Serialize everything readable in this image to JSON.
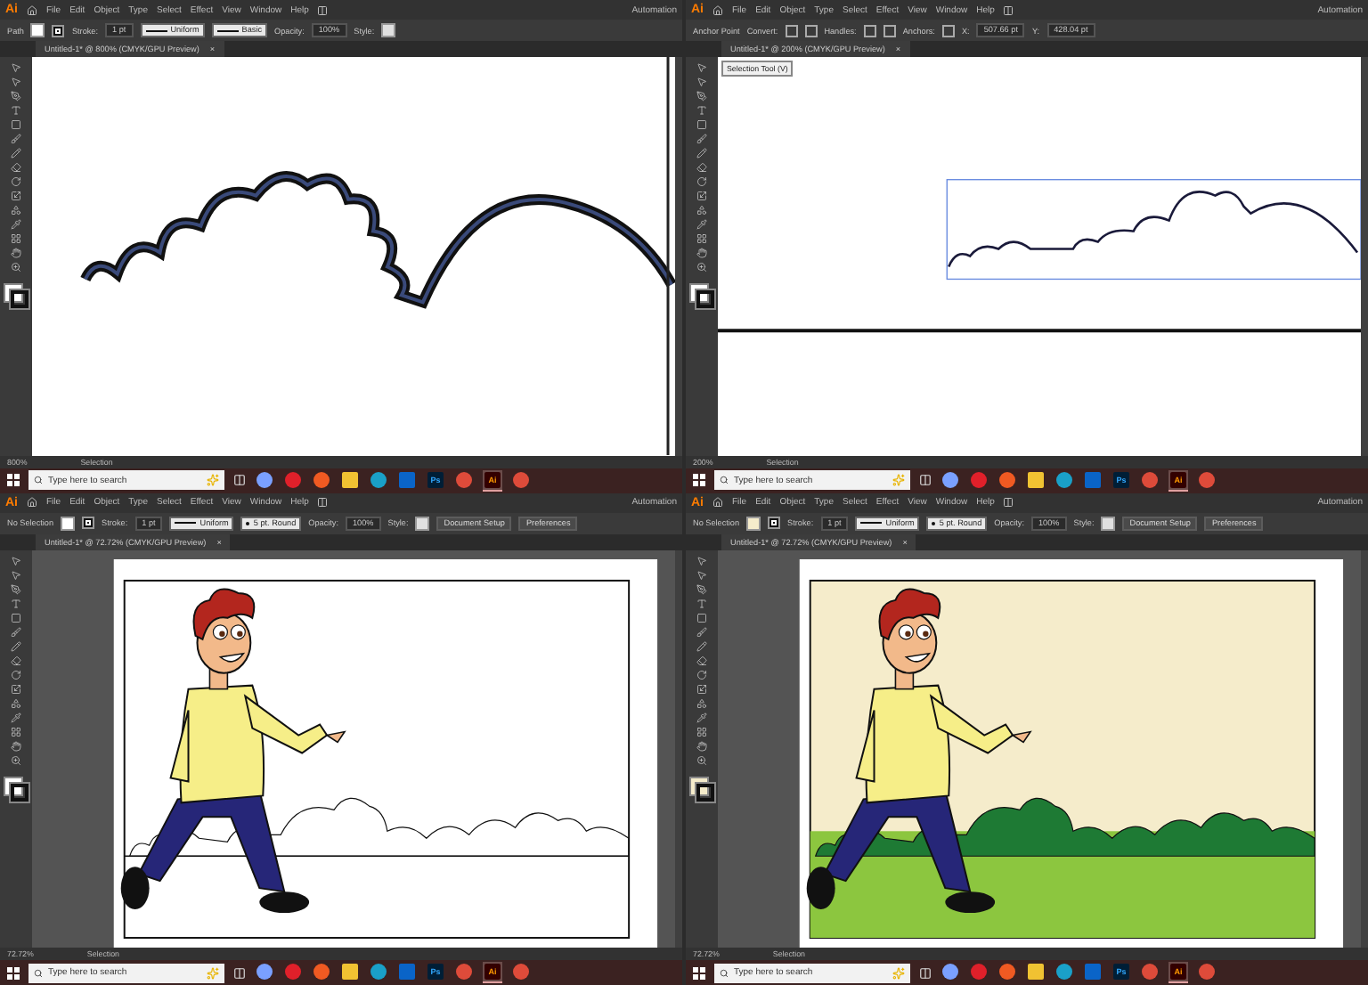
{
  "panes": [
    {
      "kind": "outline-zoom",
      "logo": "Ai",
      "menu": [
        "File",
        "Edit",
        "Object",
        "Type",
        "Select",
        "Effect",
        "View",
        "Window",
        "Help"
      ],
      "workspace": "Automation",
      "color": "#ffffff",
      "controls": [
        {
          "kind": "label",
          "text": "Path"
        },
        {
          "kind": "fill-swatch"
        },
        {
          "kind": "stroke-swatch"
        },
        {
          "kind": "label",
          "text": "Stroke:"
        },
        {
          "kind": "field",
          "text": "1 pt"
        },
        {
          "kind": "stroke-style",
          "text": "Uniform"
        },
        {
          "kind": "stroke-style",
          "text": "Basic"
        },
        {
          "kind": "label",
          "text": "Opacity:"
        },
        {
          "kind": "field",
          "text": "100%"
        },
        {
          "kind": "label",
          "text": "Style:"
        },
        {
          "kind": "style-swatch"
        }
      ],
      "tab": {
        "title": "Untitled-1* @ 800% (CMYK/GPU Preview)",
        "close": "×"
      },
      "zoom": "800%",
      "status": "Selection",
      "taskbar": {
        "placeholder": "Type here to search",
        "apps": [
          {
            "kind": "copilot",
            "selected": false
          },
          {
            "kind": "opera",
            "selected": false
          },
          {
            "kind": "brave",
            "selected": false
          },
          {
            "kind": "folder",
            "selected": false
          },
          {
            "kind": "edge",
            "selected": false
          },
          {
            "kind": "outlook",
            "selected": false
          },
          {
            "kind": "photoshop",
            "label": "Ps",
            "selected": false
          },
          {
            "kind": "chrome",
            "selected": false
          },
          {
            "kind": "illustrator",
            "label": "Ai",
            "selected": true
          },
          {
            "kind": "chrome",
            "selected": false
          }
        ]
      }
    },
    {
      "kind": "outline-selected",
      "logo": "Ai",
      "menu": [
        "File",
        "Edit",
        "Object",
        "Type",
        "Select",
        "Effect",
        "View",
        "Window",
        "Help"
      ],
      "workspace": "Automation",
      "color": "#ffffff",
      "tooltip": "Selection Tool (V)",
      "controls": [
        {
          "kind": "label",
          "text": "Anchor Point"
        },
        {
          "kind": "label",
          "text": "Convert:"
        },
        {
          "kind": "icon-button"
        },
        {
          "kind": "icon-button"
        },
        {
          "kind": "label",
          "text": "Handles:"
        },
        {
          "kind": "icon-button"
        },
        {
          "kind": "icon-button"
        },
        {
          "kind": "label",
          "text": "Anchors:"
        },
        {
          "kind": "icon-button"
        },
        {
          "kind": "label",
          "text": "X:"
        },
        {
          "kind": "field",
          "text": "507.66 pt"
        },
        {
          "kind": "label",
          "text": "Y:"
        },
        {
          "kind": "field",
          "text": "428.04 pt"
        }
      ],
      "tab": {
        "title": "Untitled-1* @ 200% (CMYK/GPU Preview)",
        "close": "×"
      },
      "zoom": "200%",
      "status": "Selection",
      "taskbar": {
        "placeholder": "Type here to search",
        "apps": [
          {
            "kind": "copilot",
            "selected": false
          },
          {
            "kind": "opera",
            "selected": false
          },
          {
            "kind": "brave",
            "selected": false
          },
          {
            "kind": "folder",
            "selected": false
          },
          {
            "kind": "edge",
            "selected": false
          },
          {
            "kind": "outlook",
            "selected": false
          },
          {
            "kind": "photoshop",
            "label": "Ps",
            "selected": false
          },
          {
            "kind": "chrome",
            "selected": false
          },
          {
            "kind": "illustrator",
            "label": "Ai",
            "selected": true
          },
          {
            "kind": "chrome",
            "selected": false
          }
        ]
      }
    },
    {
      "kind": "outline-scene",
      "logo": "Ai",
      "menu": [
        "File",
        "Edit",
        "Object",
        "Type",
        "Select",
        "Effect",
        "View",
        "Window",
        "Help"
      ],
      "workspace": "Automation",
      "color": "#ffffff",
      "controls": [
        {
          "kind": "label",
          "text": "No Selection"
        },
        {
          "kind": "fill-swatch"
        },
        {
          "kind": "stroke-swatch"
        },
        {
          "kind": "label",
          "text": "Stroke:"
        },
        {
          "kind": "field",
          "text": "1 pt"
        },
        {
          "kind": "stroke-style",
          "text": "Uniform"
        },
        {
          "kind": "brush",
          "text": "5 pt. Round"
        },
        {
          "kind": "label",
          "text": "Opacity:"
        },
        {
          "kind": "field",
          "text": "100%"
        },
        {
          "kind": "label",
          "text": "Style:"
        },
        {
          "kind": "style-swatch"
        },
        {
          "kind": "button",
          "text": "Document Setup"
        },
        {
          "kind": "button",
          "text": "Preferences"
        }
      ],
      "tab": {
        "title": "Untitled-1* @ 72.72% (CMYK/GPU Preview)",
        "close": "×"
      },
      "zoom": "72.72%",
      "status": "Selection",
      "taskbar": {
        "placeholder": "Type here to search",
        "apps": [
          {
            "kind": "copilot",
            "selected": false
          },
          {
            "kind": "opera",
            "selected": false
          },
          {
            "kind": "brave",
            "selected": false
          },
          {
            "kind": "folder",
            "selected": false
          },
          {
            "kind": "edge",
            "selected": false
          },
          {
            "kind": "outlook",
            "selected": false
          },
          {
            "kind": "photoshop",
            "label": "Ps",
            "selected": false
          },
          {
            "kind": "chrome",
            "selected": false
          },
          {
            "kind": "illustrator",
            "label": "Ai",
            "selected": true
          },
          {
            "kind": "chrome",
            "selected": false
          }
        ]
      }
    },
    {
      "kind": "color-scene",
      "logo": "Ai",
      "menu": [
        "File",
        "Edit",
        "Object",
        "Type",
        "Select",
        "Effect",
        "View",
        "Window",
        "Help"
      ],
      "workspace": "Automation",
      "color": "#f5eccb",
      "controls": [
        {
          "kind": "label",
          "text": "No Selection"
        },
        {
          "kind": "fill-swatch"
        },
        {
          "kind": "stroke-swatch"
        },
        {
          "kind": "label",
          "text": "Stroke:"
        },
        {
          "kind": "field",
          "text": "1 pt"
        },
        {
          "kind": "stroke-style",
          "text": "Uniform"
        },
        {
          "kind": "brush",
          "text": "5 pt. Round"
        },
        {
          "kind": "label",
          "text": "Opacity:"
        },
        {
          "kind": "field",
          "text": "100%"
        },
        {
          "kind": "label",
          "text": "Style:"
        },
        {
          "kind": "style-swatch"
        },
        {
          "kind": "button",
          "text": "Document Setup"
        },
        {
          "kind": "button",
          "text": "Preferences"
        }
      ],
      "tab": {
        "title": "Untitled-1* @ 72.72% (CMYK/GPU Preview)",
        "close": "×"
      },
      "zoom": "72.72%",
      "status": "Selection",
      "taskbar": {
        "placeholder": "Type here to search",
        "apps": [
          {
            "kind": "copilot",
            "selected": false
          },
          {
            "kind": "opera",
            "selected": false
          },
          {
            "kind": "brave",
            "selected": false
          },
          {
            "kind": "folder",
            "selected": false
          },
          {
            "kind": "edge",
            "selected": false
          },
          {
            "kind": "outlook",
            "selected": false
          },
          {
            "kind": "photoshop",
            "label": "Ps",
            "selected": false
          },
          {
            "kind": "chrome",
            "selected": false
          },
          {
            "kind": "illustrator",
            "label": "Ai",
            "selected": true
          },
          {
            "kind": "chrome",
            "selected": false
          }
        ]
      }
    }
  ]
}
